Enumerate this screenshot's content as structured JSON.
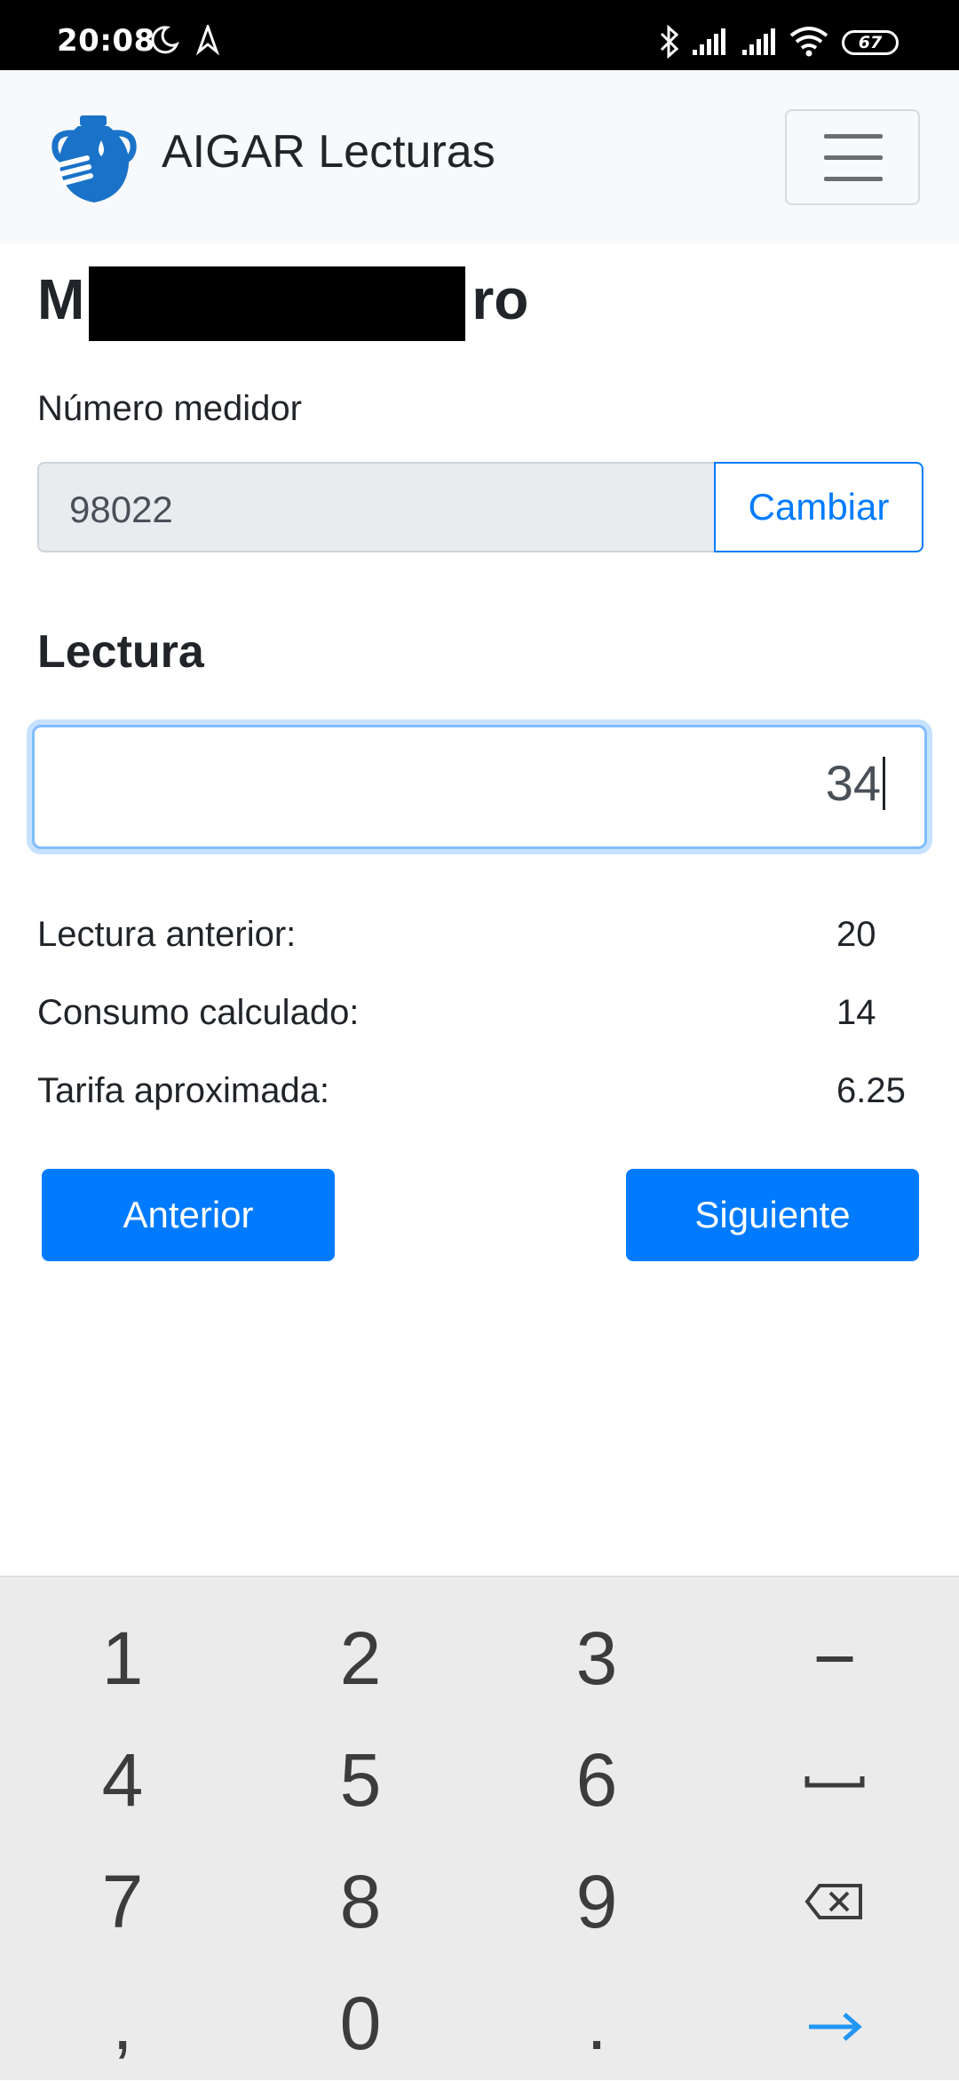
{
  "status_bar": {
    "time": "20:08",
    "battery": "67",
    "icons": [
      "moon-icon",
      "navigation-icon",
      "bluetooth-icon",
      "signal-icon",
      "signal-icon",
      "wifi-icon",
      "battery-icon"
    ]
  },
  "navbar": {
    "brand": "AIGAR Lecturas",
    "logo_icon": "water-jar-logo-icon",
    "toggler_icon": "hamburger-menu-icon"
  },
  "page": {
    "title_start": "M",
    "title_end": "ro"
  },
  "meter": {
    "label": "Número medidor",
    "value": "98022",
    "change_label": "Cambiar"
  },
  "reading": {
    "title": "Lectura",
    "value": "34"
  },
  "summary": [
    {
      "label": "Lectura anterior:",
      "value": "20"
    },
    {
      "label": "Consumo calculado:",
      "value": "14"
    },
    {
      "label": "Tarifa aproximada:",
      "value": "6.25"
    }
  ],
  "nav_buttons": {
    "previous": "Anterior",
    "next": "Siguiente"
  },
  "keyboard": {
    "keys": [
      [
        "1",
        "2",
        "3",
        "−"
      ],
      [
        "4",
        "5",
        "6",
        "␣"
      ],
      [
        "7",
        "8",
        "9",
        "⌫"
      ],
      [
        ",",
        "0",
        ".",
        "→"
      ]
    ]
  },
  "colors": {
    "primary": "#007bff",
    "navbar_bg": "#f8f9fa",
    "keyboard_bg": "#ebebeb",
    "enter_key": "#2196f3"
  }
}
